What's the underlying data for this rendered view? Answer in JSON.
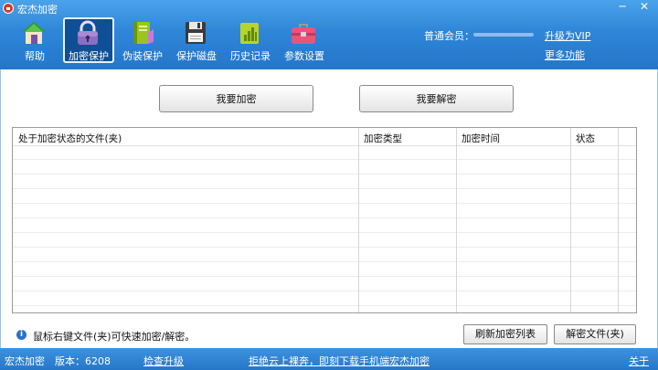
{
  "window": {
    "title": "宏杰加密",
    "minimize": "─",
    "close": "✕"
  },
  "toolbar": {
    "items": [
      {
        "label": "帮助",
        "icon": "house-icon"
      },
      {
        "label": "加密保护",
        "icon": "lock-icon",
        "active": true
      },
      {
        "label": "伪装保护",
        "icon": "book-icon"
      },
      {
        "label": "保护磁盘",
        "icon": "floppy-disk-icon"
      },
      {
        "label": "历史记录",
        "icon": "history-icon"
      },
      {
        "label": "参数设置",
        "icon": "toolbox-icon"
      }
    ]
  },
  "account": {
    "member_label": "普通会员：",
    "upgrade_vip": "升级为VIP",
    "more_features": "更多功能"
  },
  "main": {
    "encrypt_button": "我要加密",
    "decrypt_button": "我要解密",
    "table": {
      "columns": [
        "处于加密状态的文件(夹)",
        "加密类型",
        "加密时间",
        "状态"
      ],
      "rows": []
    },
    "hint": "鼠标右键文件(夹)可快速加密/解密。",
    "refresh_button": "刷新加密列表",
    "decrypt_file_button": "解密文件(夹)"
  },
  "statusbar": {
    "app_name": "宏杰加密",
    "version": "版本：6208",
    "check_upgrade": "检查升级",
    "promo": "拒绝云上裸奔，即刻下载手机端宏杰加密",
    "about": "关于"
  },
  "colors": {
    "header_blue": "#2f86d8",
    "active_tool": "#0f4f95",
    "status_blue": "#2677c8"
  }
}
